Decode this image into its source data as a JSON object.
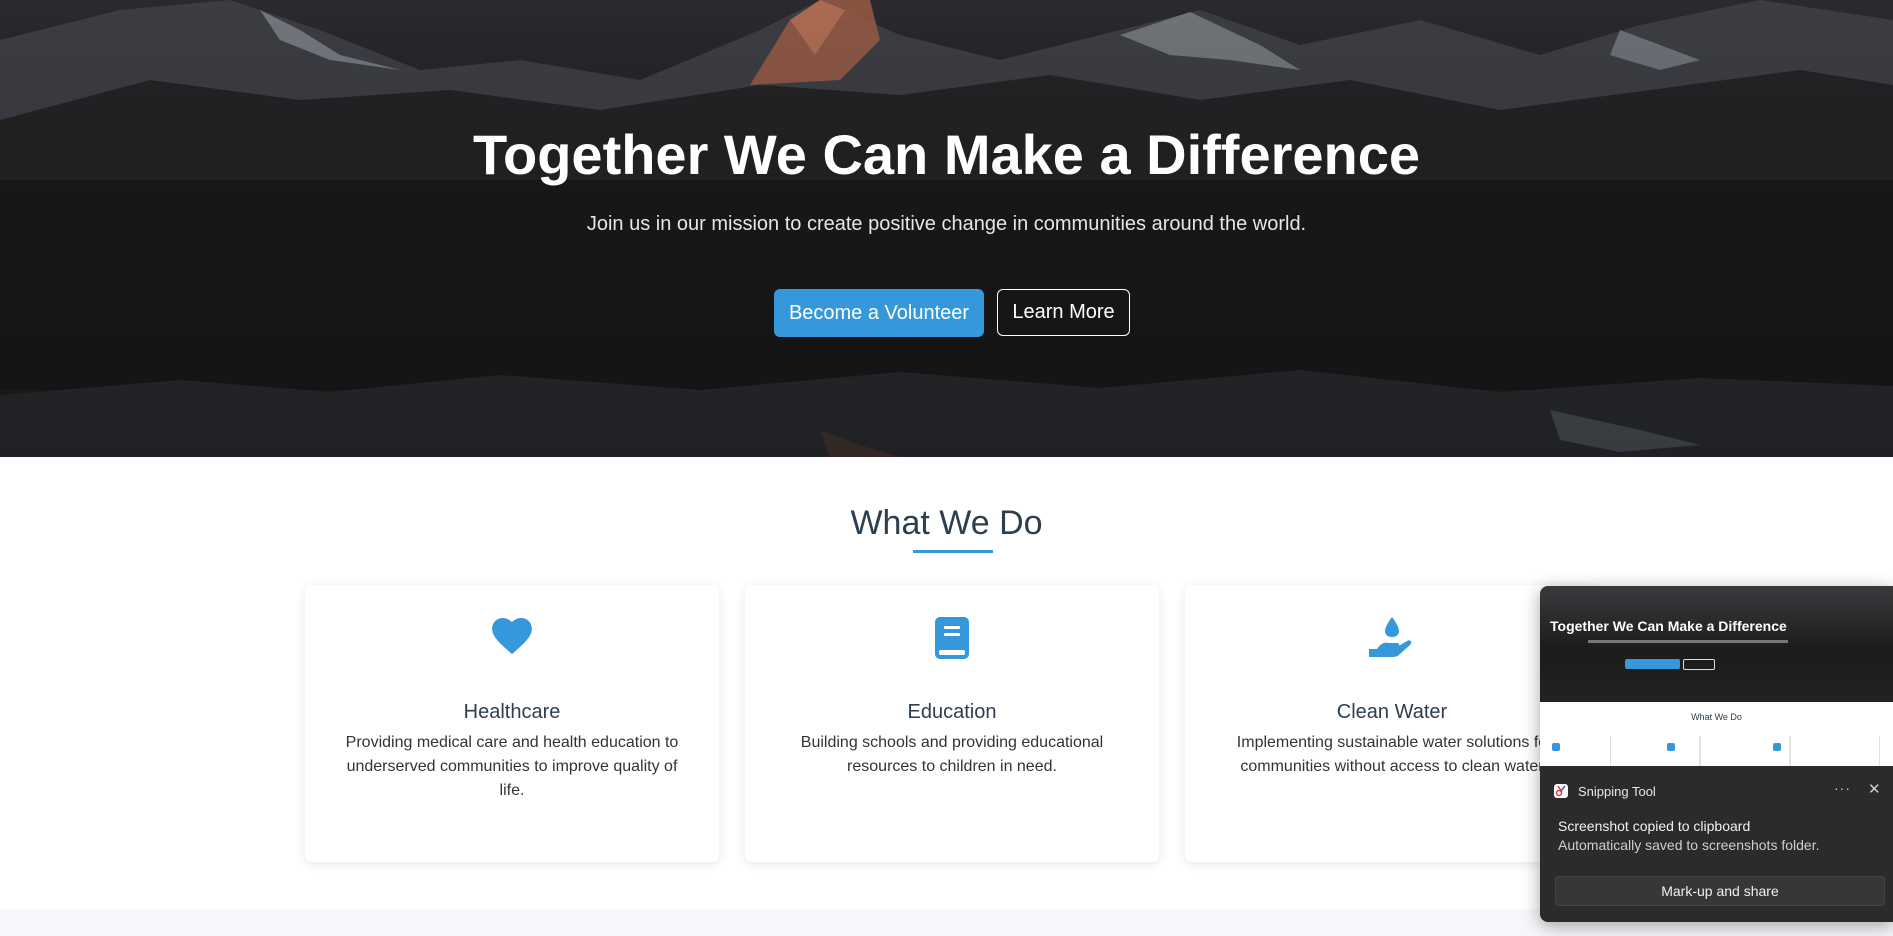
{
  "hero": {
    "title": "Together We Can Make a Difference",
    "subtitle": "Join us in our mission to create positive change in communities around the world.",
    "primary_button": "Become a Volunteer",
    "secondary_button": "Learn More"
  },
  "section": {
    "title": "What We Do"
  },
  "cards": [
    {
      "icon": "heart-icon",
      "title": "Healthcare",
      "text": "Providing medical care and health education to underserved communities to improve quality of life."
    },
    {
      "icon": "book-icon",
      "title": "Education",
      "text": "Building schools and providing educational resources to children in need."
    },
    {
      "icon": "water-hand-icon",
      "title": "Clean Water",
      "text": "Implementing sustainable water solutions fo communities without access to clean water"
    }
  ],
  "notification": {
    "app_name": "Snipping Tool",
    "more_label": "···",
    "close_label": "✕",
    "message_title": "Screenshot copied to clipboard",
    "message_body": "Automatically saved to screenshots folder.",
    "action_label": "Mark-up and share",
    "preview": {
      "title": "Together We Can Make a Difference",
      "section_title": "What We Do"
    }
  },
  "colors": {
    "accent": "#3498db",
    "heading": "#2c3e50",
    "toast_bg": "#2b2b2b"
  }
}
